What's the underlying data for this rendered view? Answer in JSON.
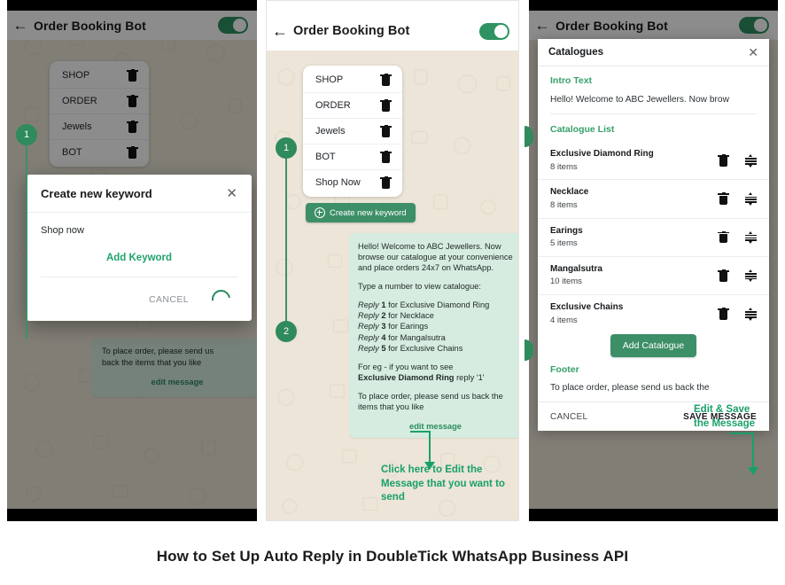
{
  "caption": "How to Set Up Auto Reply in DoubleTick WhatsApp Business API",
  "app": {
    "title": "Order Booking Bot",
    "back_icon": "back-arrow-icon",
    "toggle_state": "on"
  },
  "panel1": {
    "keywords": [
      "SHOP",
      "ORDER",
      "Jewels",
      "BOT"
    ],
    "step_badge": "1",
    "dialog": {
      "title": "Create new keyword",
      "close_icon": "close-icon",
      "input_value": "Shop now",
      "add_keyword_label": "Add Keyword",
      "cancel_label": "CANCEL",
      "spinner": "loading-spinner"
    },
    "bubble_tail": {
      "line1": "To place order, please send us",
      "line2": "back the items that you like",
      "edit_label": "edit message"
    }
  },
  "panel2": {
    "keywords": [
      "SHOP",
      "ORDER",
      "Jewels",
      "BOT",
      "Shop Now"
    ],
    "create_button": "Create new keyword",
    "create_button_icon": "plus-circle-icon",
    "badges": [
      "1",
      "2"
    ],
    "bubble": {
      "para1": "Hello! Welcome to ABC Jewellers. Now browse our catalogue at your convenience and place orders 24x7 on WhatsApp.",
      "para2": "Type a number to view catalogue:",
      "replies": [
        {
          "prefix": "Reply",
          "num": "1",
          "text": "for Exclusive Diamond Ring"
        },
        {
          "prefix": "Reply",
          "num": "2",
          "text": "for Necklace"
        },
        {
          "prefix": "Reply",
          "num": "3",
          "text": "for Earings"
        },
        {
          "prefix": "Reply",
          "num": "4",
          "text": "for Mangalsutra"
        },
        {
          "prefix": "Reply",
          "num": "5",
          "text": "for Exclusive Chains"
        }
      ],
      "eg_line1": "For eg - if you want to see",
      "eg_bold": "Exclusive Diamond Ring",
      "eg_rest": " reply '1'",
      "para3": "To place order, please send us back the items that you like",
      "edit_label": "edit message"
    },
    "callout": "Click here to Edit the Message that you want to send"
  },
  "panel3": {
    "sheet": {
      "title": "Catalogues",
      "close_icon": "close-icon",
      "intro_label": "Intro Text",
      "intro_value": "Hello! Welcome to ABC Jewellers. Now brow",
      "list_label": "Catalogue List",
      "catalogues": [
        {
          "name": "Exclusive Diamond Ring",
          "items": "8 items"
        },
        {
          "name": "Necklace",
          "items": "8 items"
        },
        {
          "name": "Earings",
          "items": "5 items"
        },
        {
          "name": "Mangalsutra",
          "items": "10 items"
        },
        {
          "name": "Exclusive Chains",
          "items": "4 items"
        }
      ],
      "row_icons": [
        "trash-icon",
        "drag-handle-icon"
      ],
      "add_catalogue": "Add Catalogue",
      "footer_label": "Footer",
      "footer_value": "To place order, please send us back the",
      "cancel_label": "CANCEL",
      "save_label": "SAVE MESSAGE"
    },
    "callout": "Edit & Save the Message"
  },
  "colors": {
    "brand_green": "#2f8a5c",
    "accent_green": "#19a06a",
    "bubble_green": "#d6ece0",
    "chat_bg": "#ece5d8"
  }
}
